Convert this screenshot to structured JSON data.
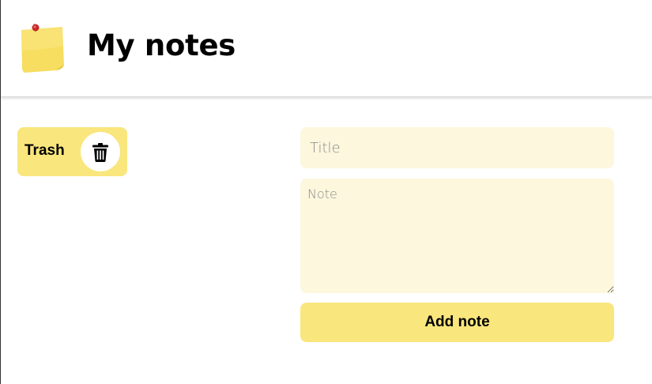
{
  "header": {
    "title": "My notes",
    "logo_icon": "sticky-note-icon"
  },
  "trash": {
    "label": "Trash",
    "icon": "trash-can-icon"
  },
  "form": {
    "title_placeholder": "Title",
    "title_value": "",
    "note_placeholder": "Note",
    "note_value": "",
    "submit_label": "Add note"
  },
  "colors": {
    "accent": "#f9e67d",
    "field_background": "#fcf7dd"
  }
}
